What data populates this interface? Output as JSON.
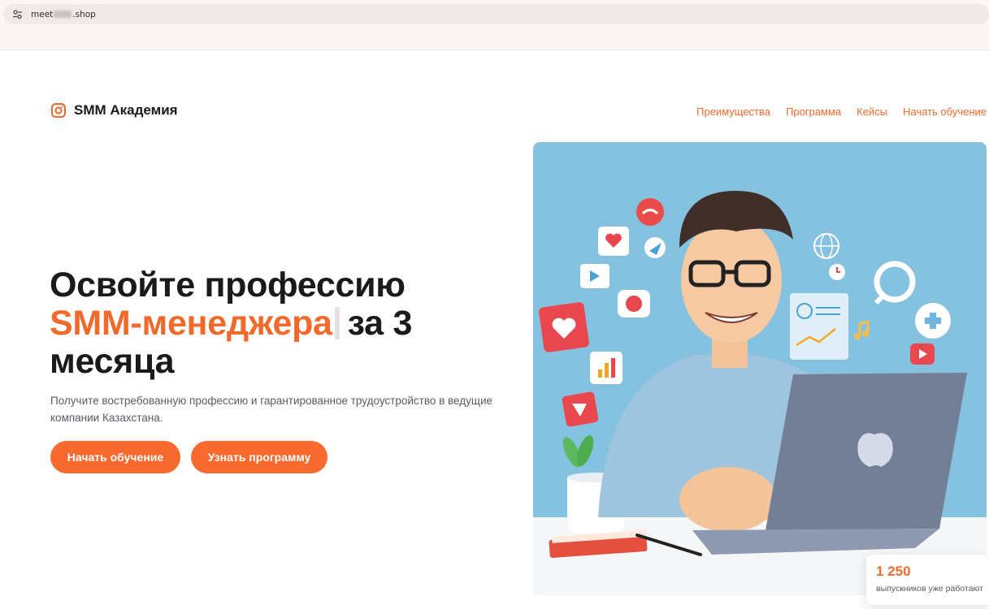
{
  "browser": {
    "url_prefix": "meet",
    "url_suffix": ".shop"
  },
  "header": {
    "logo_text": "SMM Академия",
    "logo_icon": "instagram-icon",
    "nav": [
      {
        "label": "Преимущества"
      },
      {
        "label": "Программа"
      },
      {
        "label": "Кейсы"
      },
      {
        "label": "Начать обучение"
      }
    ]
  },
  "hero": {
    "title_line1": "Освойте профессию",
    "title_accent": "SMM-менеджера",
    "title_rest": "за 3",
    "title_line3": "месяца",
    "subtitle": "Получите востребованную профессию и гарантированное трудоустройство в ведущие компании Казахстана.",
    "primary_button": "Начать обучение",
    "secondary_button": "Узнать программу"
  },
  "stat": {
    "number": "1 250",
    "label": "выпускников уже работают"
  },
  "colors": {
    "accent": "#f26a2b",
    "button": "#f96a2e",
    "illustration_bg": "#85c2df"
  }
}
